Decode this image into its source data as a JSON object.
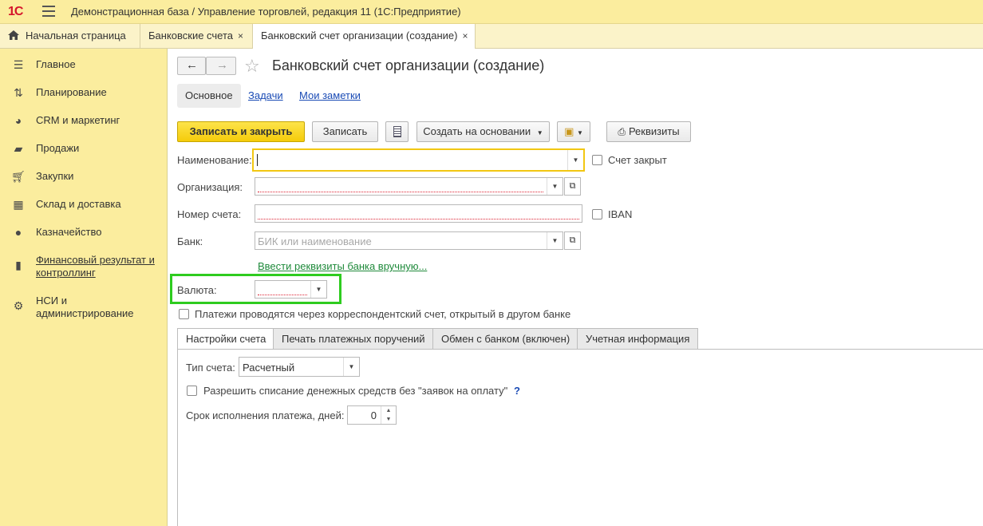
{
  "titlebar": {
    "logo": "1С",
    "title": "Демонстрационная база / Управление торговлей, редакция 11  (1С:Предприятие)"
  },
  "window_tabs": [
    {
      "label": "Начальная страница"
    },
    {
      "label": "Банковские счета",
      "close": "×"
    },
    {
      "label": "Банковский счет организации (создание)",
      "close": "×"
    }
  ],
  "sidebar": {
    "items": [
      {
        "label": "Главное",
        "icon": "menu-lines-icon"
      },
      {
        "label": "Планирование",
        "icon": "planning-icon"
      },
      {
        "label": "CRM и маркетинг",
        "icon": "pie-chart-icon"
      },
      {
        "label": "Продажи",
        "icon": "shopping-bag-icon"
      },
      {
        "label": "Закупки",
        "icon": "cart-icon"
      },
      {
        "label": "Склад и доставка",
        "icon": "warehouse-grid-icon"
      },
      {
        "label": "Казначейство",
        "icon": "ruble-icon"
      },
      {
        "label": "Финансовый результат и контроллинг",
        "icon": "bar-chart-icon"
      },
      {
        "label": "НСИ и администрирование",
        "icon": "gear-icon"
      }
    ]
  },
  "form": {
    "title": "Банковский счет организации (создание)",
    "section_tabs": [
      "Основное",
      "Задачи",
      "Мои заметки"
    ],
    "toolbar": {
      "save_close": "Записать и закрыть",
      "save": "Записать",
      "create_based": "Создать на основании",
      "requisites": "Реквизиты"
    },
    "fields": {
      "name_label": "Наименование:",
      "name_value": "",
      "closed_label": "Счет закрыт",
      "org_label": "Организация:",
      "account_label": "Номер счета:",
      "iban_label": "IBAN",
      "bank_label": "Банк:",
      "bank_placeholder": "БИК или наименование",
      "manual_link": "Ввести реквизиты банка вручную...",
      "currency_label": "Валюта:",
      "corr_label": "Платежи проводятся через корреспондентский счет, открытый в другом банке"
    },
    "panel_tabs": [
      "Настройки счета",
      "Печать платежных поручений",
      "Обмен с банком (включен)",
      "Учетная информация"
    ],
    "settings": {
      "type_label": "Тип счета:",
      "type_value": "Расчетный",
      "allow_label": "Разрешить списание денежных средств без \"заявок на оплату\"",
      "help": "?",
      "term_label": "Срок исполнения платежа, дней:",
      "term_value": "0"
    }
  },
  "colors": {
    "sidebar_bg": "#fbed9e",
    "primary_button": "#f5cc0a",
    "highlight": "#2ecc1f",
    "link": "#1a4bb5"
  }
}
